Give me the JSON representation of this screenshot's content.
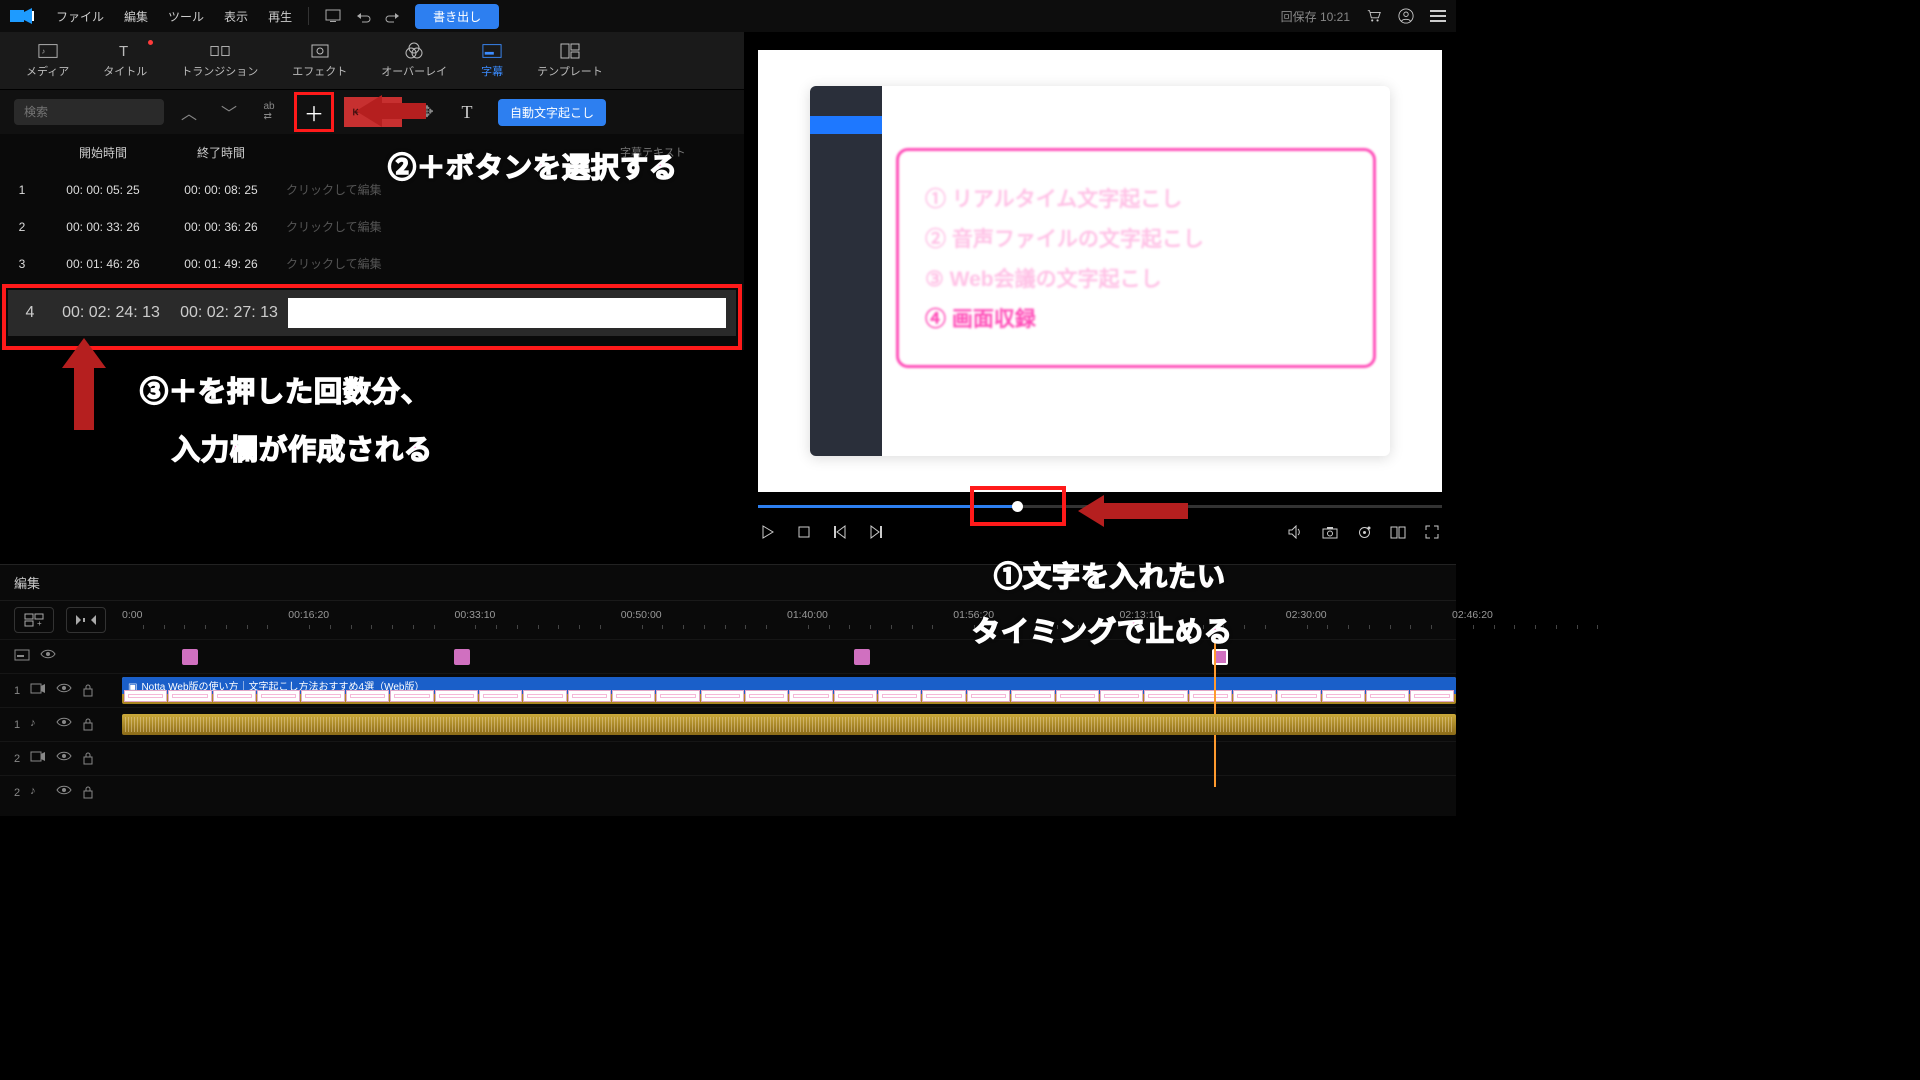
{
  "topbar": {
    "menus": [
      "ファイル",
      "編集",
      "ツール",
      "表示",
      "再生"
    ],
    "export": "書き出し",
    "save_time": "回保存 10:21"
  },
  "tabs": {
    "media": "メディア",
    "title": "タイトル",
    "transition": "トランジション",
    "effect": "エフェクト",
    "overlay": "オーバーレイ",
    "subtitle": "字幕",
    "template": "テンプレート"
  },
  "toolbar": {
    "search_placeholder": "検索",
    "auto_transcribe": "自動文字起こし",
    "subtitle_text_hint": "字幕テキスト"
  },
  "list": {
    "col_start": "開始時間",
    "col_end": "終了時間",
    "click_edit": "クリックして編集",
    "rows": [
      {
        "idx": "1",
        "start": "00: 00: 05: 25",
        "end": "00: 00: 08: 25"
      },
      {
        "idx": "2",
        "start": "00: 00: 33: 26",
        "end": "00: 00: 36: 26"
      },
      {
        "idx": "3",
        "start": "00: 01: 46: 26",
        "end": "00: 01: 49: 26"
      },
      {
        "idx": "4",
        "start": "00: 02: 24: 13",
        "end": "00: 02: 27: 13"
      }
    ]
  },
  "preview": {
    "features": [
      "① リアルタイム文字起こし",
      "② 音声ファイルの文字起こし",
      "③ Web会議の文字起こし",
      "④ 画面収録"
    ]
  },
  "timeline": {
    "tab": "編集",
    "ruler": [
      "0:00",
      "00:16:20",
      "00:33:10",
      "00:50:00",
      "01:40:00",
      "01:56:20",
      "02:13:10",
      "02:30:00",
      "02:46:20"
    ],
    "clip_title": "Notta Web版の使い方｜文字起こし方法おすすめ4選（Web版）",
    "tracks": {
      "v1": "1",
      "a1": "1",
      "v2": "2",
      "a2": "2"
    }
  },
  "anno": {
    "a2": "②＋ボタンを選択する",
    "a3a": "③＋を押した回数分、",
    "a3b": "入力欄が作成される",
    "a1a": "①文字を入れたい",
    "a1b": "タイミングで止める"
  }
}
